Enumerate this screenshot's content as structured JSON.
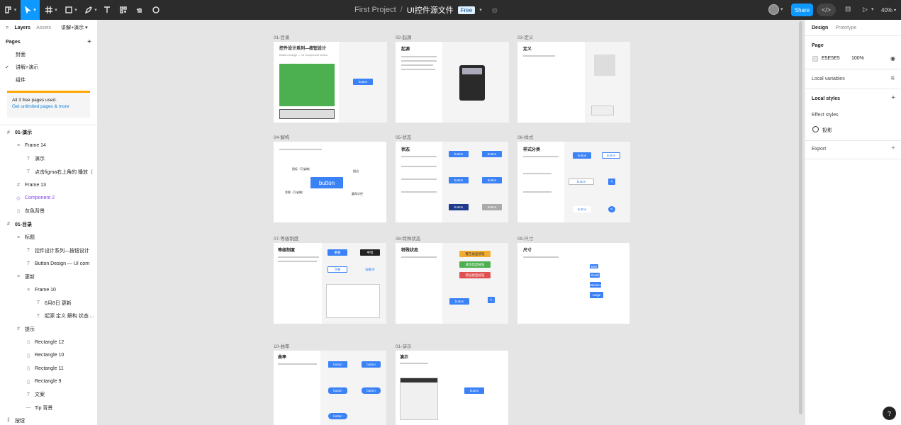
{
  "toolbar": {
    "project": "First Project",
    "separator": "/",
    "file_name": "UI控件源文件",
    "plan_badge": "Free",
    "share_label": "Share",
    "code_label": "</>",
    "zoom": "40%"
  },
  "left_panel": {
    "tabs": {
      "layers": "Layers",
      "assets": "Assets",
      "page_switch": "讲解+演示"
    },
    "pages_title": "Pages",
    "pages": [
      {
        "label": "封面",
        "current": false
      },
      {
        "label": "讲解+演示",
        "current": true
      },
      {
        "label": "组件",
        "current": false
      }
    ],
    "notice": {
      "line1": "All 3 free pages used.",
      "line2": "Get unlimited pages & more"
    },
    "layers": [
      {
        "label": "01-演示",
        "indent": 0,
        "icon": "grid",
        "top": true
      },
      {
        "label": "Frame 14",
        "indent": 1,
        "icon": "lines"
      },
      {
        "label": "演示",
        "indent": 2,
        "icon": "T"
      },
      {
        "label": "点击figma右上角的 播放（",
        "indent": 2,
        "icon": "T"
      },
      {
        "label": "Frame 13",
        "indent": 1,
        "icon": "grid"
      },
      {
        "label": "Component 2",
        "indent": 1,
        "icon": "diamond",
        "comp": true
      },
      {
        "label": "灰色背景",
        "indent": 1,
        "icon": "rect"
      },
      {
        "label": "01-目录",
        "indent": 0,
        "icon": "grid",
        "top": true
      },
      {
        "label": "标题",
        "indent": 1,
        "icon": "lines"
      },
      {
        "label": "控件设计系列—按钮设计",
        "indent": 2,
        "icon": "T"
      },
      {
        "label": "Button Design — UI com",
        "indent": 2,
        "icon": "T"
      },
      {
        "label": "更新",
        "indent": 1,
        "icon": "lines"
      },
      {
        "label": "Frame 10",
        "indent": 2,
        "icon": "lines"
      },
      {
        "label": "6月8日 更新",
        "indent": 3,
        "icon": "T"
      },
      {
        "label": "起源 定义 解构 状态 ...",
        "indent": 3,
        "icon": "T"
      },
      {
        "label": "提示",
        "indent": 1,
        "icon": "grid"
      },
      {
        "label": "Rectangle 12",
        "indent": 2,
        "icon": "rect"
      },
      {
        "label": "Rectangle 10",
        "indent": 2,
        "icon": "rect"
      },
      {
        "label": "Rectangle 11",
        "indent": 2,
        "icon": "rect"
      },
      {
        "label": "Rectangle 9",
        "indent": 2,
        "icon": "rect"
      },
      {
        "label": "文案",
        "indent": 2,
        "icon": "T"
      },
      {
        "label": "Tip 背景",
        "indent": 2,
        "icon": "line"
      },
      {
        "label": "按钮",
        "indent": 0,
        "icon": "bars"
      }
    ]
  },
  "canvas": {
    "frames": [
      {
        "label": "01-目录",
        "title": "控件设计系列—按钮设计",
        "subtitle": "Button Design — UI component series"
      },
      {
        "label": "02-起源",
        "title": "起源"
      },
      {
        "label": "03-定义",
        "title": "定义"
      },
      {
        "label": "04-解构",
        "title": "",
        "center_button": "button"
      },
      {
        "label": "05-状态",
        "title": "状态"
      },
      {
        "label": "06-样式",
        "title": "样式分类"
      },
      {
        "label": "07-等级制度",
        "title": "等级制度"
      },
      {
        "label": "08-特殊状态",
        "title": "特殊状态"
      },
      {
        "label": "09-尺寸",
        "title": "尺寸"
      },
      {
        "label": "10-曲率",
        "title": "曲率"
      },
      {
        "label": "01-演示",
        "title": "演示"
      }
    ],
    "button_text": "button",
    "hierarchy_buttons": {
      "primary": "重要",
      "secondary": "中等",
      "plain": "次要",
      "weak": "弱重点"
    },
    "diagram_labels": {
      "icon": "图标（可省略）",
      "text": "文本",
      "bg": "背景（可省略）",
      "corner": "圆角半径",
      "border": "描边",
      "outline": "边框",
      "height": "高度"
    },
    "special_buttons": [
      "警告类型按钮",
      "成功类型按钮",
      "错误类型按钮"
    ],
    "size_labels": [
      "Mini",
      "Small",
      "Medium",
      "Large"
    ]
  },
  "right_panel": {
    "tabs": {
      "design": "Design",
      "prototype": "Prototype"
    },
    "page_title": "Page",
    "page_color": "E5E5E5",
    "page_opacity": "100%",
    "local_variables": "Local variables",
    "local_styles": "Local styles",
    "effect_styles": "Effect styles",
    "effect_item": "投影",
    "export": "Export"
  },
  "help": "?",
  "colors": {
    "accent": "#0d99ff",
    "toolbar": "#2c2c2c",
    "canvas": "#e5e5e5",
    "button_blue": "#3b82f6",
    "green": "#4caf50"
  }
}
